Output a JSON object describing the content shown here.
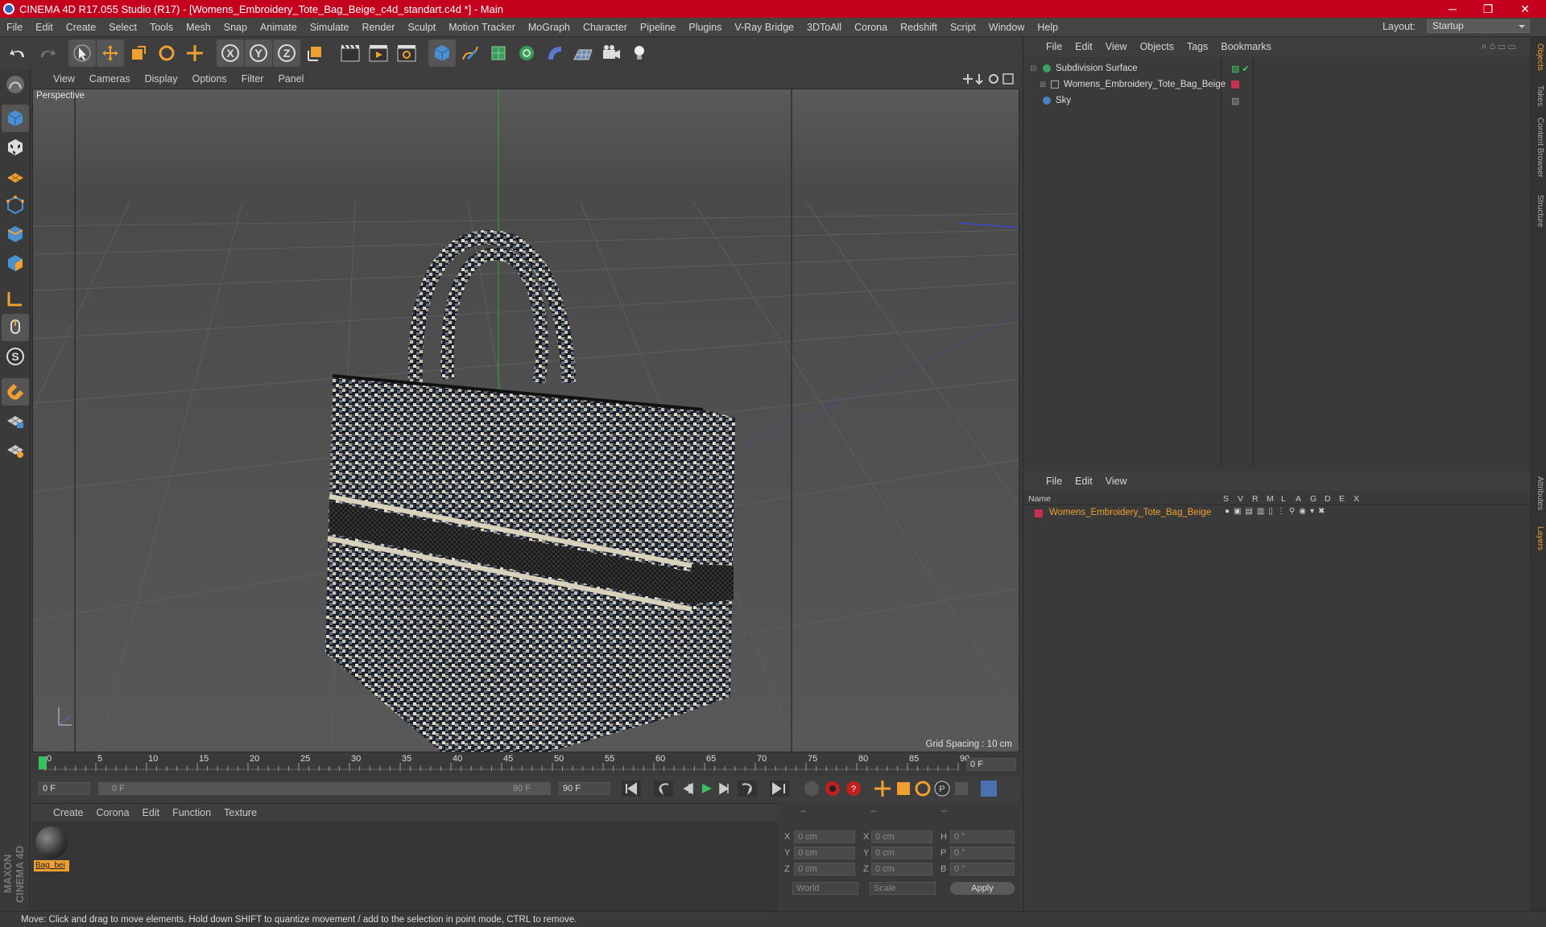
{
  "window": {
    "title": "CINEMA 4D R17.055 Studio (R17) - [Womens_Embroidery_Tote_Bag_Beige_c4d_standart.c4d *] - Main",
    "minimize": "─",
    "maximize": "❐",
    "close": "✕"
  },
  "menu": [
    "File",
    "Edit",
    "Create",
    "Select",
    "Tools",
    "Mesh",
    "Snap",
    "Animate",
    "Simulate",
    "Render",
    "Sculpt",
    "Motion Tracker",
    "MoGraph",
    "Character",
    "Pipeline",
    "Plugins",
    "V-Ray Bridge",
    "3DToAll",
    "Corona",
    "Redshift",
    "Script",
    "Window",
    "Help"
  ],
  "layout": {
    "label": "Layout:",
    "value": "Startup"
  },
  "viewport": {
    "menu": [
      "View",
      "Cameras",
      "Display",
      "Options",
      "Filter",
      "Panel"
    ],
    "label": "Perspective",
    "grid_spacing": "Grid Spacing : 10 cm"
  },
  "timeline": {
    "ticks": [
      "0",
      "5",
      "10",
      "15",
      "20",
      "25",
      "30",
      "35",
      "40",
      "45",
      "50",
      "55",
      "60",
      "65",
      "70",
      "75",
      "80",
      "85",
      "90"
    ],
    "end_field": "0 F",
    "start": "0 F",
    "range_start": "0 F",
    "range_end": "90 F",
    "end": "90 F"
  },
  "material_panel": {
    "menu": [
      "Create",
      "Corona",
      "Edit",
      "Function",
      "Texture"
    ],
    "material_name": "Bag_bei"
  },
  "coords": {
    "header": [
      "--",
      "--",
      "--"
    ],
    "rows": [
      {
        "a": "X",
        "av": "0 cm",
        "b": "X",
        "bv": "0 cm",
        "c": "H",
        "cv": "0 °"
      },
      {
        "a": "Y",
        "av": "0 cm",
        "b": "Y",
        "bv": "0 cm",
        "c": "P",
        "cv": "0 °"
      },
      {
        "a": "Z",
        "av": "0 cm",
        "b": "Z",
        "bv": "0 cm",
        "c": "B",
        "cv": "0 °"
      }
    ],
    "mode": "World",
    "transform": "Scale",
    "apply": "Apply"
  },
  "object_manager": {
    "menu": [
      "File",
      "Edit",
      "View",
      "Objects",
      "Tags",
      "Bookmarks"
    ],
    "items": [
      {
        "name": "Subdivision Surface",
        "indent": 0
      },
      {
        "name": "Womens_Embroidery_Tote_Bag_Beige",
        "indent": 1
      },
      {
        "name": "Sky",
        "indent": 0
      }
    ]
  },
  "layer_manager": {
    "menu": [
      "File",
      "Edit",
      "View"
    ],
    "columns": [
      "Name",
      "S",
      "V",
      "R",
      "M",
      "L",
      "A",
      "G",
      "D",
      "E",
      "X"
    ],
    "layer_name": "Womens_Embroidery_Tote_Bag_Beige"
  },
  "right_tabs": [
    "Objects",
    "Takes",
    "Content Browser",
    "Structure",
    "Attributes",
    "Layers"
  ],
  "brand": "MAXON CINEMA 4D",
  "status": "Move: Click and drag to move elements. Hold down SHIFT to quantize movement / add to the selection in point mode, CTRL to remove.",
  "colors": {
    "title_bar": "#c5001c",
    "accent_orange": "#f0a030",
    "layer_color": "#c83050"
  }
}
